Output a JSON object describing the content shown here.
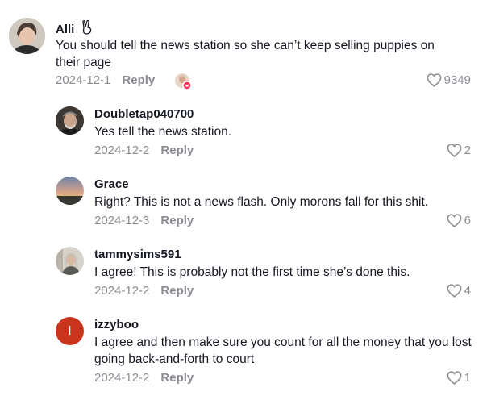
{
  "top": {
    "username": "Alli",
    "text": "You should tell the news station so she can’t keep selling puppies on their page",
    "date": "2024-12-1",
    "reply_label": "Reply",
    "likes": "9349"
  },
  "replies": [
    {
      "username": "Doubletap040700",
      "text": "Yes tell the news station.",
      "date": "2024-12-2",
      "reply_label": "Reply",
      "likes": "2"
    },
    {
      "username": "Grace",
      "text": "Right? This is not a news flash. Only morons fall for this shit.",
      "date": "2024-12-3",
      "reply_label": "Reply",
      "likes": "6"
    },
    {
      "username": "tammysims591",
      "text": "I agree! This is probably not the first time she’s done this.",
      "date": "2024-12-2",
      "reply_label": "Reply",
      "likes": "4"
    },
    {
      "username": "izzyboo",
      "avatar_letter": "I",
      "text": "I agree and then make sure you count for all the money that you lost going back-and-forth to court",
      "date": "2024-12-2",
      "reply_label": "Reply",
      "likes": "1"
    }
  ],
  "colors": {
    "meta": "#8a8b91",
    "text": "#161823",
    "avatar_izzy": "#c9341d",
    "liked_badge": "#fe2c55"
  },
  "icons": {
    "like": "heart-outline-icon",
    "creator_liked": "creator-liked-avatar-icon",
    "emoji": "peace-hand-emoji"
  }
}
